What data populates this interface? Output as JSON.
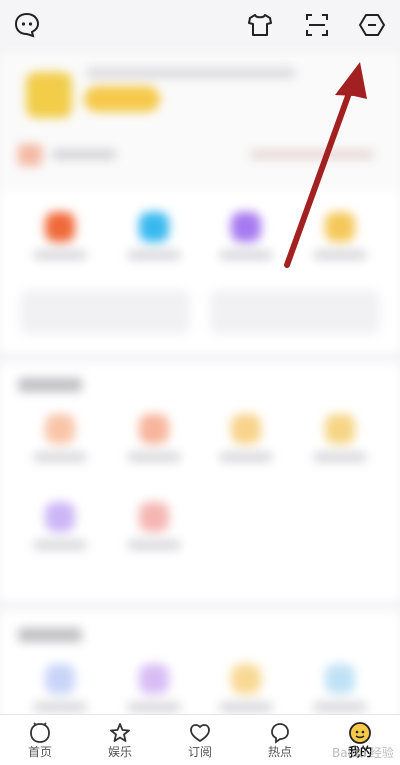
{
  "top_icons": [
    "smiley-message-icon",
    "tshirt-icon",
    "scan-icon",
    "more-hexagon-icon"
  ],
  "tabs": [
    {
      "label": "首页",
      "icon": "home-icon",
      "active": false
    },
    {
      "label": "娱乐",
      "icon": "star-icon",
      "active": false
    },
    {
      "label": "订阅",
      "icon": "heart-icon",
      "active": false
    },
    {
      "label": "热点",
      "icon": "hot-icon",
      "active": false
    },
    {
      "label": "我的",
      "icon": "avatar-icon",
      "active": true
    }
  ],
  "watermark": "Baidu 经验",
  "colors": {
    "arrow": "#a32020",
    "accent": "#f6c94a"
  }
}
